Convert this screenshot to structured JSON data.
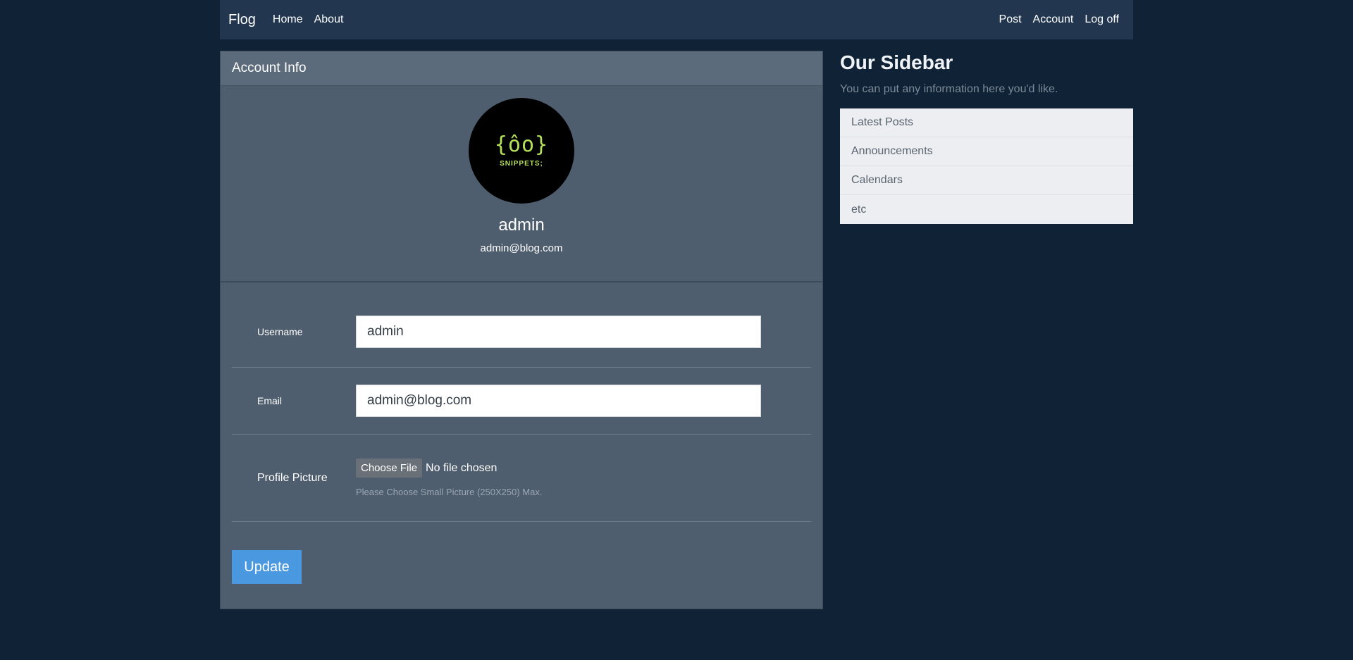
{
  "nav": {
    "brand": "Flog",
    "left_links": [
      "Home",
      "About"
    ],
    "right_links": [
      "Post",
      "Account",
      "Log off"
    ]
  },
  "card": {
    "header": "Account Info",
    "avatar": {
      "mark": "{ôo}",
      "text": "SNIPPETS;"
    },
    "username": "admin",
    "email": "admin@blog.com"
  },
  "form": {
    "username_label": "Username",
    "username_value": "admin",
    "email_label": "Email",
    "email_value": "admin@blog.com",
    "picture_label": "Profile Picture",
    "file_button": "Choose File",
    "file_status": "No file chosen",
    "file_help": "Please Choose Small Picture (250X250) Max.",
    "submit": "Update"
  },
  "sidebar": {
    "title": "Our Sidebar",
    "subtitle": "You can put any information here you'd like.",
    "items": [
      "Latest Posts",
      "Announcements",
      "Calendars",
      "etc"
    ]
  },
  "colors": {
    "page_bg": "#0f2236",
    "navbar_bg": "#22374f",
    "card_bg": "#4e5e6f",
    "accent": "#4a98e0",
    "avatar_green": "#b5e05a"
  }
}
